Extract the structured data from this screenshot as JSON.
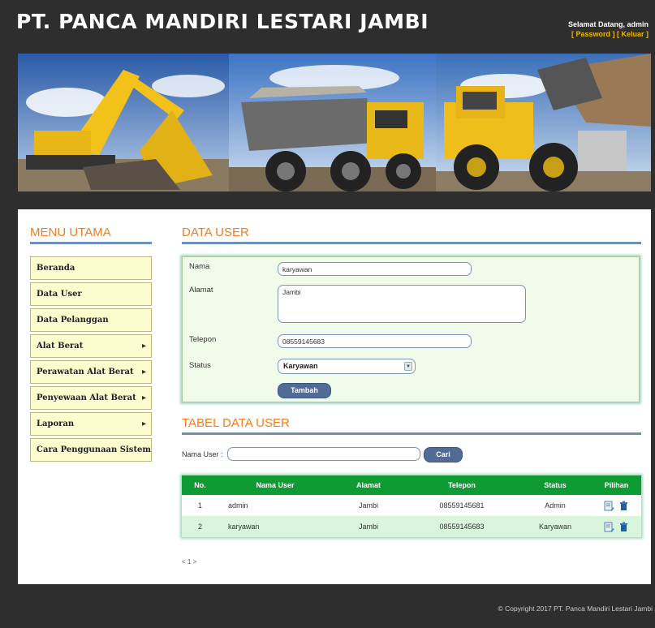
{
  "header": {
    "site_title": "PT. PANCA MANDIRI LESTARI JAMBI",
    "welcome_text": "Selamat Datang, admin",
    "password_link": "[ Password ]",
    "logout_link": "[ Keluar ]"
  },
  "sidebar": {
    "title": "MENU UTAMA",
    "items": [
      {
        "label": "Beranda"
      },
      {
        "label": "Data User"
      },
      {
        "label": "Data Pelanggan"
      },
      {
        "label": "Alat Berat"
      },
      {
        "label": "Perawatan Alat Berat"
      },
      {
        "label": "Penyewaan Alat Berat"
      },
      {
        "label": "Laporan"
      },
      {
        "label": "Cara Penggunaan Sistem"
      }
    ]
  },
  "form": {
    "title": "DATA USER",
    "nama_label": "Nama",
    "nama_value": "karyawan",
    "alamat_label": "Alamat",
    "alamat_value": "Jambi",
    "telepon_label": "Telepon",
    "telepon_value": "08559145683",
    "status_label": "Status",
    "status_value": "Karyawan",
    "submit_label": "Tambah"
  },
  "table_section": {
    "title": "TABEL DATA USER",
    "search_label": "Nama User :",
    "search_value": "",
    "search_button": "Cari",
    "columns": [
      "No.",
      "Nama User",
      "Alamat",
      "Telepon",
      "Status",
      "Pilihan"
    ],
    "rows": [
      {
        "no": "1",
        "nama": "admin",
        "alamat": "Jambi",
        "telepon": "08559145681",
        "status": "Admin"
      },
      {
        "no": "2",
        "nama": "karyawan",
        "alamat": "Jambi",
        "telepon": "08559145683",
        "status": "Karyawan"
      }
    ],
    "pager": "< 1 >"
  },
  "footer": {
    "copyright": "© Copyright 2017 PT. Panca Mandiri Lestari Jambi"
  }
}
